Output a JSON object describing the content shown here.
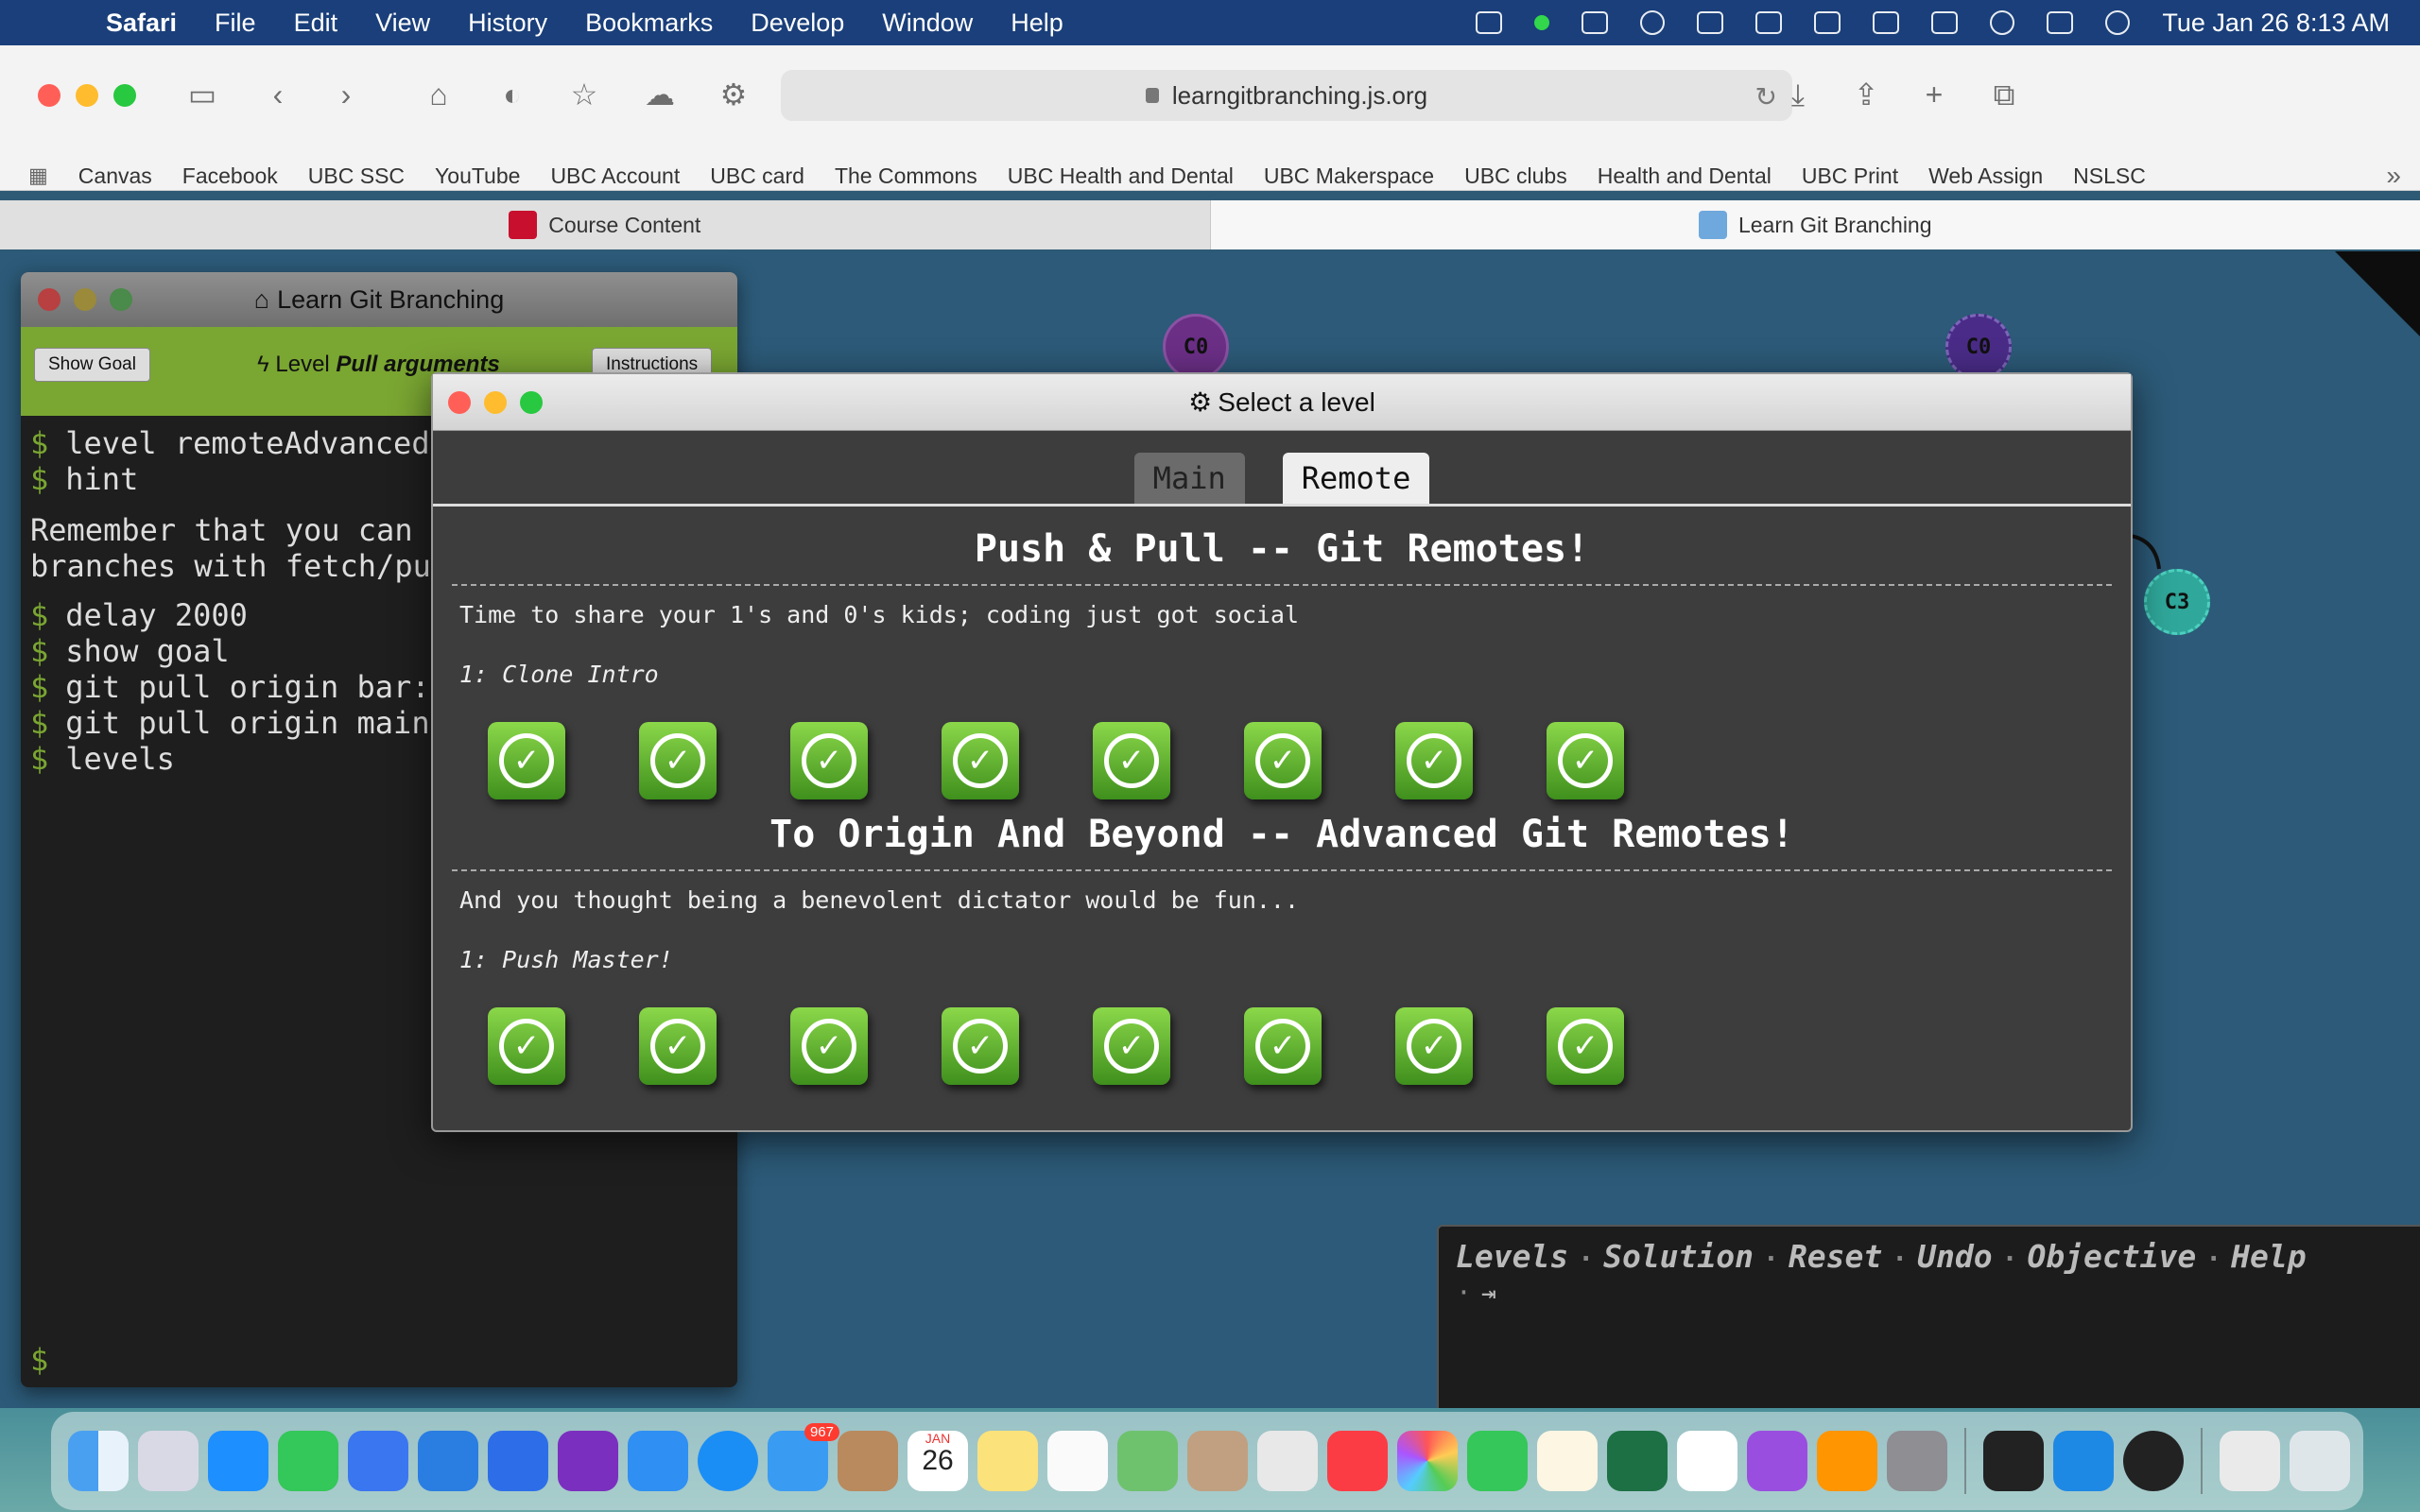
{
  "menubar": {
    "app": "Safari",
    "items": [
      "File",
      "Edit",
      "View",
      "History",
      "Bookmarks",
      "Develop",
      "Window",
      "Help"
    ],
    "clock": "Tue Jan 26  8:13 AM"
  },
  "browser": {
    "url": "learngitbranching.js.org",
    "favorites": [
      "Canvas",
      "Facebook",
      "UBC SSC",
      "YouTube",
      "UBC Account",
      "UBC card",
      "The Commons",
      "UBC Health and Dental",
      "UBC Makerspace",
      "UBC clubs",
      "Health and Dental",
      "UBC Print",
      "Web Assign",
      "NSLSC"
    ],
    "tabs": [
      {
        "label": "Course Content",
        "active": false
      },
      {
        "label": "Learn Git Branching",
        "active": true
      }
    ]
  },
  "graph": {
    "nodes": [
      {
        "label": "C0",
        "style": "purple"
      },
      {
        "label": "C0",
        "style": "dpurple"
      },
      {
        "label": "C3",
        "style": "teal"
      }
    ]
  },
  "terminal": {
    "title": "Learn Git Branching",
    "show_goal": "Show Goal",
    "instructions": "Instructions",
    "level_prefix": "Level",
    "level_name": "Pull arguments",
    "lines_a": [
      "level remoteAdvanced",
      "hint"
    ],
    "hint_text_1": "Remember that you can",
    "hint_text_2": "branches with fetch/pu",
    "lines_b": [
      "delay 2000",
      "show goal",
      "git pull origin bar:",
      "git pull origin main",
      "levels"
    ],
    "prompt": "$"
  },
  "modal": {
    "title": "Select a level",
    "tabs": [
      {
        "label": "Main",
        "active": false
      },
      {
        "label": "Remote",
        "active": true
      }
    ],
    "sequences": [
      {
        "title": "Push & Pull -- Git Remotes!",
        "about": "Time to share your 1's and 0's kids; coding just got social",
        "first": "1: Clone Intro",
        "levels_completed": 8
      },
      {
        "title": "To Origin And Beyond -- Advanced Git Remotes!",
        "about": "And you thought being a benevolent dictator would be fun...",
        "first": "1: Push Master!",
        "levels_completed": 8
      }
    ]
  },
  "commandbar": {
    "links": [
      "Levels",
      "Solution",
      "Reset",
      "Undo",
      "Objective",
      "Help"
    ]
  },
  "dock": {
    "mail_badge": "967",
    "calendar_month": "JAN",
    "calendar_day": "26"
  }
}
